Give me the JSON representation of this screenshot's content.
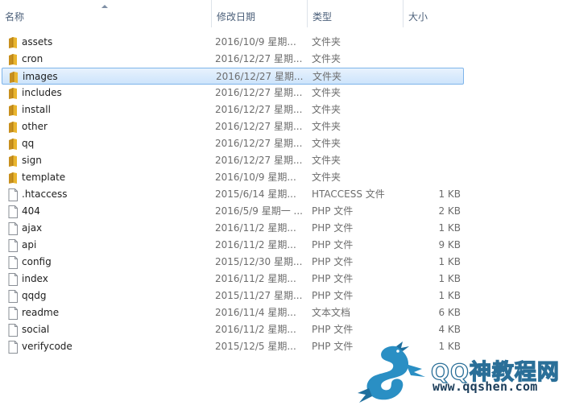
{
  "columns": {
    "name": "名称",
    "date": "修改日期",
    "type": "类型",
    "size": "大小"
  },
  "files": [
    {
      "name": "assets",
      "date": "2016/10/9 星期...",
      "type": "文件夹",
      "size": "",
      "kind": "folder"
    },
    {
      "name": "cron",
      "date": "2016/12/27 星期...",
      "type": "文件夹",
      "size": "",
      "kind": "folder"
    },
    {
      "name": "images",
      "date": "2016/12/27 星期...",
      "type": "文件夹",
      "size": "",
      "kind": "folder",
      "selected": true
    },
    {
      "name": "includes",
      "date": "2016/12/27 星期...",
      "type": "文件夹",
      "size": "",
      "kind": "folder"
    },
    {
      "name": "install",
      "date": "2016/12/27 星期...",
      "type": "文件夹",
      "size": "",
      "kind": "folder"
    },
    {
      "name": "other",
      "date": "2016/12/27 星期...",
      "type": "文件夹",
      "size": "",
      "kind": "folder"
    },
    {
      "name": "qq",
      "date": "2016/12/27 星期...",
      "type": "文件夹",
      "size": "",
      "kind": "folder"
    },
    {
      "name": "sign",
      "date": "2016/12/27 星期...",
      "type": "文件夹",
      "size": "",
      "kind": "folder"
    },
    {
      "name": "template",
      "date": "2016/10/9 星期...",
      "type": "文件夹",
      "size": "",
      "kind": "folder"
    },
    {
      "name": ".htaccess",
      "date": "2015/6/14 星期...",
      "type": "HTACCESS 文件",
      "size": "1 KB",
      "kind": "file"
    },
    {
      "name": "404",
      "date": "2016/5/9 星期一 ...",
      "type": "PHP 文件",
      "size": "2 KB",
      "kind": "file"
    },
    {
      "name": "ajax",
      "date": "2016/11/2 星期...",
      "type": "PHP 文件",
      "size": "1 KB",
      "kind": "file"
    },
    {
      "name": "api",
      "date": "2016/11/2 星期...",
      "type": "PHP 文件",
      "size": "9 KB",
      "kind": "file"
    },
    {
      "name": "config",
      "date": "2015/12/30 星期...",
      "type": "PHP 文件",
      "size": "1 KB",
      "kind": "file"
    },
    {
      "name": "index",
      "date": "2016/11/2 星期...",
      "type": "PHP 文件",
      "size": "1 KB",
      "kind": "file"
    },
    {
      "name": "qqdg",
      "date": "2015/11/27 星期...",
      "type": "PHP 文件",
      "size": "1 KB",
      "kind": "file"
    },
    {
      "name": "readme",
      "date": "2016/11/4 星期...",
      "type": "文本文档",
      "size": "6 KB",
      "kind": "file"
    },
    {
      "name": "social",
      "date": "2016/11/2 星期...",
      "type": "PHP 文件",
      "size": "4 KB",
      "kind": "file"
    },
    {
      "name": "verifycode",
      "date": "2015/12/5 星期...",
      "type": "PHP 文件",
      "size": "1 KB",
      "kind": "file"
    }
  ],
  "watermark": {
    "title": "QQ神教程网",
    "url": "www.qqshen.com"
  },
  "colors": {
    "folder": "#e9b52e",
    "selection_border": "#7eb4ea",
    "selection_fill": "#cde4fb",
    "header_text": "#4c607a",
    "watermark_blue": "#2a8fc4"
  }
}
